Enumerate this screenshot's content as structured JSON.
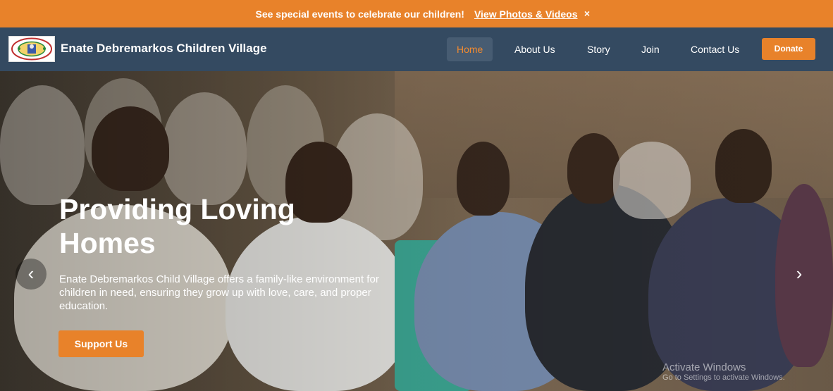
{
  "announcement": {
    "message": "See special events to celebrate our children!",
    "link_label": "View Photos & Videos",
    "close_label": "×"
  },
  "navbar": {
    "brand": "Enate Debremarkos Children Village",
    "items": [
      {
        "label": "Home",
        "active": true
      },
      {
        "label": "About Us",
        "active": false
      },
      {
        "label": "Story",
        "active": false
      },
      {
        "label": "Join",
        "active": false
      },
      {
        "label": "Contact Us",
        "active": false
      }
    ],
    "donate_label": "Donate"
  },
  "hero": {
    "title": "Providing Loving Homes",
    "text": "Enate Debremarkos Child Village offers a family-like environment for children in need, ensuring they grow up with love, care, and proper education.",
    "cta_label": "Support Us",
    "prev_icon": "chevron-left-icon",
    "next_icon": "chevron-right-icon"
  },
  "watermark": {
    "title": "Activate Windows",
    "subtitle": "Go to Settings to activate Windows."
  },
  "colors": {
    "accent": "#e8822a",
    "navbar": "#344a61",
    "active_nav_text": "#f08a30"
  }
}
